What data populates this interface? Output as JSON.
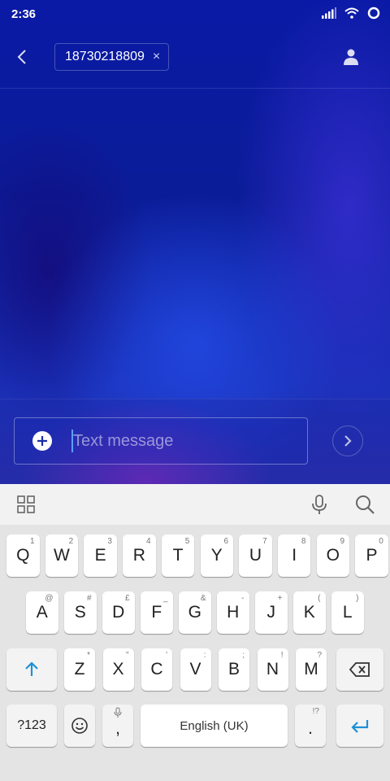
{
  "status_bar": {
    "time": "2:36"
  },
  "header": {
    "recipient": "18730218809",
    "chip_close": "×"
  },
  "compose": {
    "placeholder": "Text message"
  },
  "keyboard": {
    "row1": [
      {
        "label": "Q",
        "alt": "1"
      },
      {
        "label": "W",
        "alt": "2"
      },
      {
        "label": "E",
        "alt": "3"
      },
      {
        "label": "R",
        "alt": "4"
      },
      {
        "label": "T",
        "alt": "5"
      },
      {
        "label": "Y",
        "alt": "6"
      },
      {
        "label": "U",
        "alt": "7"
      },
      {
        "label": "I",
        "alt": "8"
      },
      {
        "label": "O",
        "alt": "9"
      },
      {
        "label": "P",
        "alt": "0"
      }
    ],
    "row2": [
      {
        "label": "A",
        "alt": "@"
      },
      {
        "label": "S",
        "alt": "#"
      },
      {
        "label": "D",
        "alt": "£"
      },
      {
        "label": "F",
        "alt": "_"
      },
      {
        "label": "G",
        "alt": "&"
      },
      {
        "label": "H",
        "alt": "-"
      },
      {
        "label": "J",
        "alt": "+"
      },
      {
        "label": "K",
        "alt": "("
      },
      {
        "label": "L",
        "alt": ")"
      }
    ],
    "row3": [
      {
        "label": "Z",
        "alt": "*"
      },
      {
        "label": "X",
        "alt": "\""
      },
      {
        "label": "C",
        "alt": "'"
      },
      {
        "label": "V",
        "alt": ":"
      },
      {
        "label": "B",
        "alt": ";"
      },
      {
        "label": "N",
        "alt": "!"
      },
      {
        "label": "M",
        "alt": "?"
      }
    ],
    "symbols_label": "?123",
    "comma_label": ",",
    "space_label": "English (UK)",
    "period_label": ".",
    "period_alt": "!?"
  }
}
